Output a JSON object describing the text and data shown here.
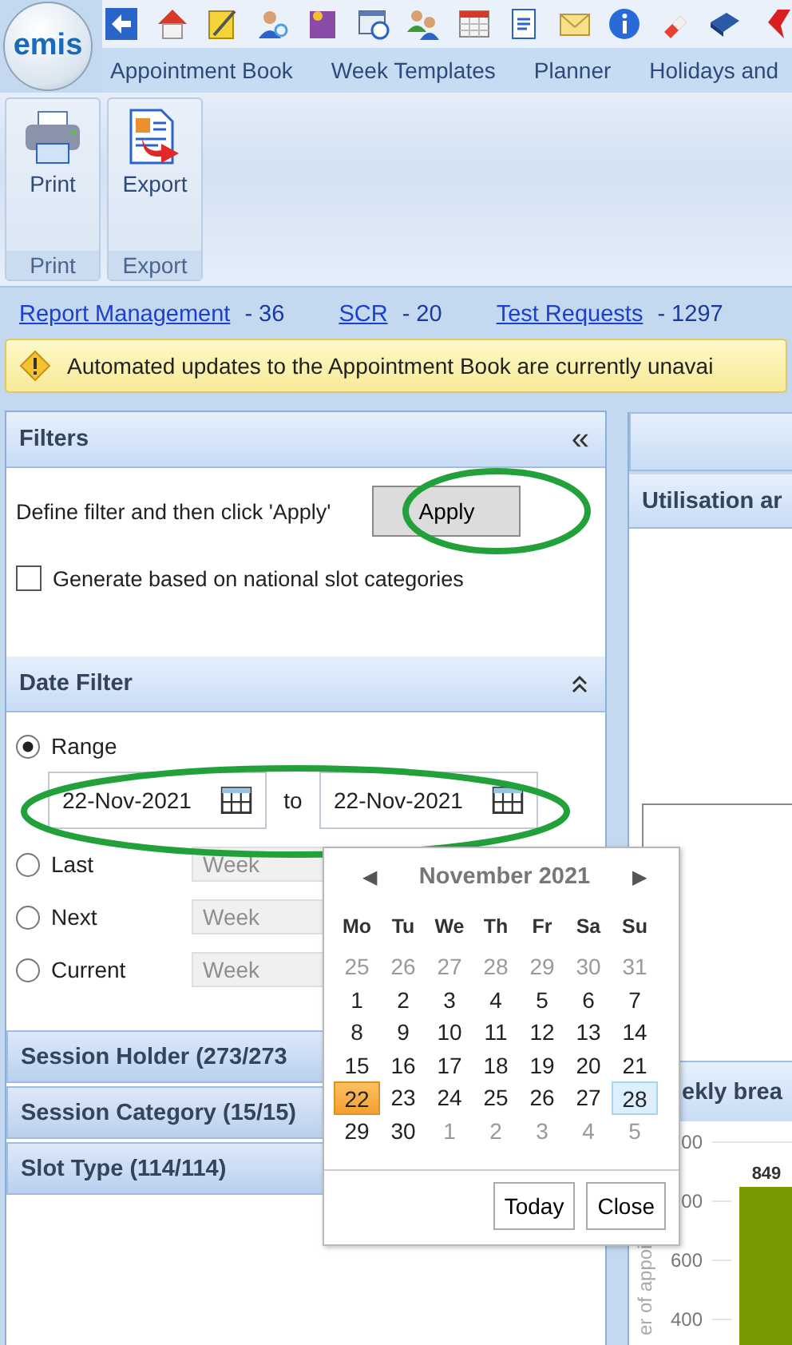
{
  "app": {
    "logo": "emis"
  },
  "nav_tabs": [
    {
      "label": "Appointment Book"
    },
    {
      "label": "Week Templates"
    },
    {
      "label": "Planner"
    },
    {
      "label": "Holidays and"
    }
  ],
  "ribbon": [
    {
      "kind": "print",
      "button": "Print",
      "group": "Print"
    },
    {
      "kind": "export",
      "button": "Export",
      "group": "Export"
    }
  ],
  "counters": [
    {
      "link": "Report Management",
      "count": "- 36"
    },
    {
      "link": "SCR",
      "count": "- 20"
    },
    {
      "link": "Test Requests",
      "count": "- 1297"
    }
  ],
  "warning": {
    "text": "Automated updates to the Appointment Book are currently unavai"
  },
  "filters": {
    "title": "Filters",
    "collapse": "«",
    "instruction": "Define filter and then click 'Apply'",
    "apply_button": "Apply",
    "national_slots": {
      "label": "Generate based on national slot categories",
      "checked": false
    }
  },
  "date_filter": {
    "title": "Date Filter",
    "options": [
      {
        "kind": "range",
        "label": "Range",
        "selected": true,
        "from": "22-Nov-2021",
        "separator": "to",
        "to": "22-Nov-2021"
      },
      {
        "kind": "period",
        "label": "Last",
        "selected": false,
        "period": "Week",
        "disabled": true
      },
      {
        "kind": "period",
        "label": "Next",
        "selected": false,
        "period": "Week",
        "disabled": true
      },
      {
        "kind": "period",
        "label": "Current",
        "selected": false,
        "period": "Week",
        "disabled": true
      }
    ]
  },
  "sections": [
    {
      "title": "Session Holder (273/273"
    },
    {
      "title": "Session Category (15/15)"
    },
    {
      "title": "Slot Type (114/114)"
    }
  ],
  "calendar": {
    "prev": "◀",
    "month": "November 2021",
    "next": "▶",
    "weekdays": [
      "Mo",
      "Tu",
      "We",
      "Th",
      "Fr",
      "Sa",
      "Su"
    ],
    "weeks": [
      [
        {
          "day": "25",
          "outside": true,
          "selected": false,
          "highlighted": false
        },
        {
          "day": "26",
          "outside": true,
          "selected": false,
          "highlighted": false
        },
        {
          "day": "27",
          "outside": true,
          "selected": false,
          "highlighted": false
        },
        {
          "day": "28",
          "outside": true,
          "selected": false,
          "highlighted": false
        },
        {
          "day": "29",
          "outside": true,
          "selected": false,
          "highlighted": false
        },
        {
          "day": "30",
          "outside": true,
          "selected": false,
          "highlighted": false
        },
        {
          "day": "31",
          "outside": true,
          "selected": false,
          "highlighted": false
        }
      ],
      [
        {
          "day": "1",
          "outside": false,
          "selected": false,
          "highlighted": false
        },
        {
          "day": "2",
          "outside": false,
          "selected": false,
          "highlighted": false
        },
        {
          "day": "3",
          "outside": false,
          "selected": false,
          "highlighted": false
        },
        {
          "day": "4",
          "outside": false,
          "selected": false,
          "highlighted": false
        },
        {
          "day": "5",
          "outside": false,
          "selected": false,
          "highlighted": false
        },
        {
          "day": "6",
          "outside": false,
          "selected": false,
          "highlighted": false
        },
        {
          "day": "7",
          "outside": false,
          "selected": false,
          "highlighted": false
        }
      ],
      [
        {
          "day": "8",
          "outside": false,
          "selected": false,
          "highlighted": false
        },
        {
          "day": "9",
          "outside": false,
          "selected": false,
          "highlighted": false
        },
        {
          "day": "10",
          "outside": false,
          "selected": false,
          "highlighted": false
        },
        {
          "day": "11",
          "outside": false,
          "selected": false,
          "highlighted": false
        },
        {
          "day": "12",
          "outside": false,
          "selected": false,
          "highlighted": false
        },
        {
          "day": "13",
          "outside": false,
          "selected": false,
          "highlighted": false
        },
        {
          "day": "14",
          "outside": false,
          "selected": false,
          "highlighted": false
        }
      ],
      [
        {
          "day": "15",
          "outside": false,
          "selected": false,
          "highlighted": false
        },
        {
          "day": "16",
          "outside": false,
          "selected": false,
          "highlighted": false
        },
        {
          "day": "17",
          "outside": false,
          "selected": false,
          "highlighted": false
        },
        {
          "day": "18",
          "outside": false,
          "selected": false,
          "highlighted": false
        },
        {
          "day": "19",
          "outside": false,
          "selected": false,
          "highlighted": false
        },
        {
          "day": "20",
          "outside": false,
          "selected": false,
          "highlighted": false
        },
        {
          "day": "21",
          "outside": false,
          "selected": false,
          "highlighted": false
        }
      ],
      [
        {
          "day": "22",
          "outside": false,
          "selected": true,
          "highlighted": false
        },
        {
          "day": "23",
          "outside": false,
          "selected": false,
          "highlighted": false
        },
        {
          "day": "24",
          "outside": false,
          "selected": false,
          "highlighted": false
        },
        {
          "day": "25",
          "outside": false,
          "selected": false,
          "highlighted": false
        },
        {
          "day": "26",
          "outside": false,
          "selected": false,
          "highlighted": false
        },
        {
          "day": "27",
          "outside": false,
          "selected": false,
          "highlighted": false
        },
        {
          "day": "28",
          "outside": false,
          "selected": false,
          "highlighted": true
        }
      ],
      [
        {
          "day": "29",
          "outside": false,
          "selected": false,
          "highlighted": false
        },
        {
          "day": "30",
          "outside": false,
          "selected": false,
          "highlighted": false
        },
        {
          "day": "1",
          "outside": true,
          "selected": false,
          "highlighted": false
        },
        {
          "day": "2",
          "outside": true,
          "selected": false,
          "highlighted": false
        },
        {
          "day": "3",
          "outside": true,
          "selected": false,
          "highlighted": false
        },
        {
          "day": "4",
          "outside": true,
          "selected": false,
          "highlighted": false
        },
        {
          "day": "5",
          "outside": true,
          "selected": false,
          "highlighted": false
        }
      ]
    ],
    "buttons": [
      "Today",
      "Close"
    ]
  },
  "report": {
    "panel_title": "Utilisation ar",
    "chart_title": "ekly brea",
    "axis_title": "er of appoi",
    "axis_ticks": [
      "00",
      "00",
      "600",
      "400"
    ],
    "bar_label": "849"
  }
}
